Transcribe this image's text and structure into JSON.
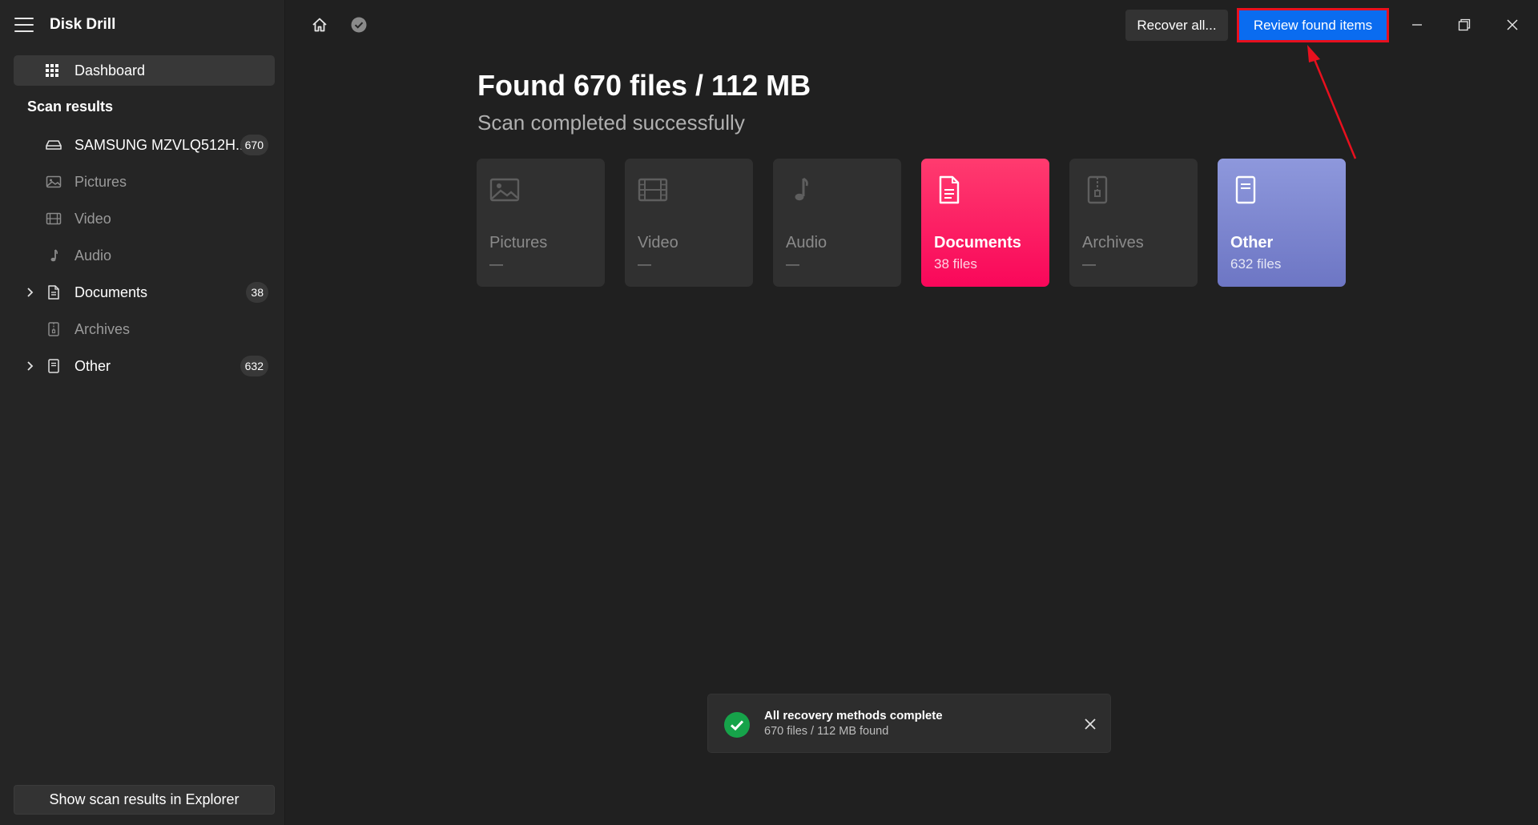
{
  "app": {
    "title": "Disk Drill"
  },
  "sidebar": {
    "dashboard_label": "Dashboard",
    "scan_results_title": "Scan results",
    "drive": {
      "label": "SAMSUNG MZVLQ512H...",
      "count": "670"
    },
    "items": [
      {
        "label": "Pictures",
        "count": null,
        "icon": "image-icon",
        "expandable": false,
        "dimmed": true
      },
      {
        "label": "Video",
        "count": null,
        "icon": "film-icon",
        "expandable": false,
        "dimmed": true
      },
      {
        "label": "Audio",
        "count": null,
        "icon": "music-note-icon",
        "expandable": false,
        "dimmed": true
      },
      {
        "label": "Documents",
        "count": "38",
        "icon": "document-icon",
        "expandable": true,
        "dimmed": false
      },
      {
        "label": "Archives",
        "count": null,
        "icon": "archive-icon",
        "expandable": false,
        "dimmed": true
      },
      {
        "label": "Other",
        "count": "632",
        "icon": "file-icon",
        "expandable": true,
        "dimmed": false
      }
    ],
    "explorer_button": "Show scan results in Explorer"
  },
  "topbar": {
    "recover_all": "Recover all...",
    "review_found": "Review found items"
  },
  "main": {
    "headline": "Found 670 files / 112 MB",
    "subheadline": "Scan completed successfully",
    "categories": [
      {
        "name": "Pictures",
        "count": "—",
        "icon": "image-icon",
        "style": "empty"
      },
      {
        "name": "Video",
        "count": "—",
        "icon": "film-icon",
        "style": "empty"
      },
      {
        "name": "Audio",
        "count": "—",
        "icon": "music-note-icon",
        "style": "empty"
      },
      {
        "name": "Documents",
        "count": "38 files",
        "icon": "document-icon",
        "style": "documents"
      },
      {
        "name": "Archives",
        "count": "—",
        "icon": "archive-icon",
        "style": "empty"
      },
      {
        "name": "Other",
        "count": "632 files",
        "icon": "file-icon",
        "style": "other"
      }
    ]
  },
  "toast": {
    "title": "All recovery methods complete",
    "body": "670 files / 112 MB found"
  },
  "colors": {
    "background": "#202020",
    "sidebar": "#252525",
    "accent_blue": "#0a6cf0",
    "annotation_red": "#e8101e",
    "documents_pink": "#fb0f5e",
    "other_lavender": "#7c85cf",
    "success_green": "#16a34a"
  }
}
